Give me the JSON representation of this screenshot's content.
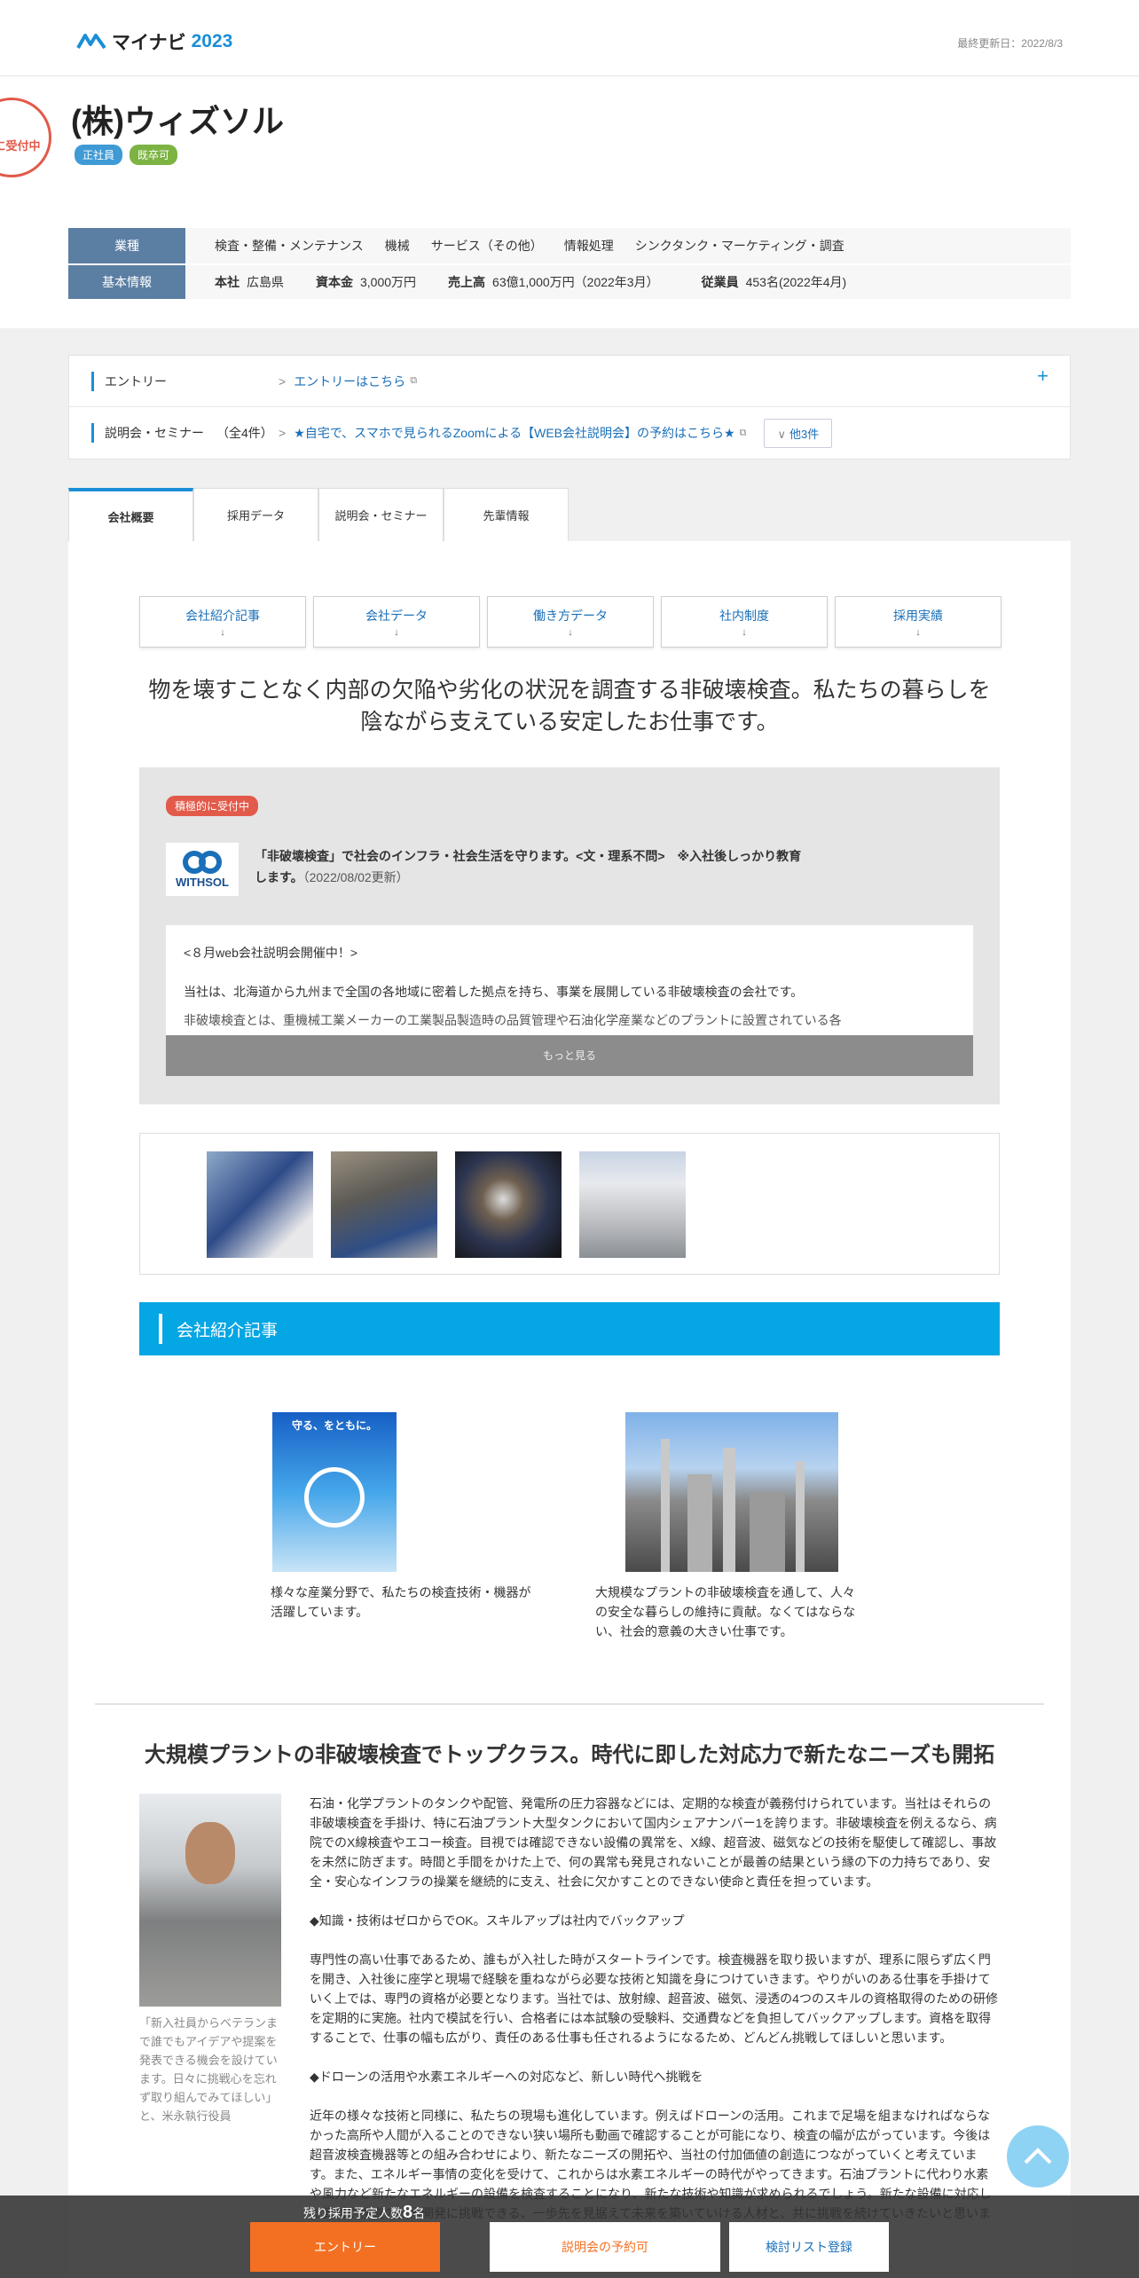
{
  "header": {
    "logo_text": "マイナビ",
    "logo_year": "2023",
    "updated": "最終更新日：2022/8/3"
  },
  "company": {
    "seal": "的に受付中",
    "name": "(株)ウィズソル",
    "tags": [
      "正社員",
      "既卒可"
    ]
  },
  "info": {
    "industry_label": "業種",
    "industries": [
      "検査・整備・メンテナンス",
      "機械",
      "サービス（その他）",
      "情報処理",
      "シンクタンク・マーケティング・調査"
    ],
    "basic_label": "基本情報",
    "hq_label": "本社",
    "hq": "広島県",
    "capital_label": "資本金",
    "capital": "3,000万円",
    "sales_label": "売上高",
    "sales": "63億1,000万円（2022年3月）",
    "employees_label": "従業員",
    "employees": "453名(2022年4月)"
  },
  "entry": {
    "entry_label": "エントリー",
    "entry_link": "エントリーはこちら",
    "seminar_label": "説明会・セミナー",
    "seminar_count": "（全4件）",
    "seminar_link": "★自宅で、スマホで見られるZoomによる【WEB会社説明会】の予約はこちら★",
    "others": "他3件",
    "plus": "+"
  },
  "tabs": [
    "会社概要",
    "採用データ",
    "説明会・セミナー",
    "先輩情報"
  ],
  "subnav": [
    "会社紹介記事",
    "会社データ",
    "働き方データ",
    "社内制度",
    "採用実績"
  ],
  "lead": "物を壊すことなく内部の欠陥や劣化の状況を調査する非破壊検査。私たちの暮らしを陰ながら支えている安定したお仕事です。",
  "message": {
    "badge": "積極的に受付中",
    "logo_text": "WITHSOL",
    "title": "「非破壊検査」で社会のインフラ・社会生活を守ります。<文・理系不問>　※入社後しっかり教育します。",
    "date": "（2022/08/02更新）",
    "p1": "<８月web会社説明会開催中！>",
    "p2": "当社は、北海道から九州まで全国の各地域に密着した拠点を持ち、事業を展開している非破壊検査の会社です。",
    "p3": "非破壊検査とは、重機械工業メーカーの工業製品製造時の品質管理や石油化学産業などのプラントに設置されている各",
    "more": "もっと見る"
  },
  "section_title": "会社紹介記事",
  "articles": [
    {
      "poster_text": "守る、をともに。",
      "caption": "様々な産業分野で、私たちの検査技術・機器が活躍しています。"
    },
    {
      "caption": "大規模なプラントの非破壊検査を通して、人々の安全な暮らしの維持に貢献。なくてはならない、社会的意義の大きい仕事です。"
    }
  ],
  "feature": {
    "heading": "大規模プラントの非破壊検査でトップクラス。時代に即した対応力で新たなニーズも開拓",
    "caption": "「新入社員からベテランまで誰でもアイデアや提案を発表できる機会を設けています。日々に挑戦心を忘れず取り組んでみてほしい」と、米永執行役員",
    "paragraphs": [
      "石油・化学プラントのタンクや配管、発電所の圧力容器などには、定期的な検査が義務付けられています。当社はそれらの非破壊検査を手掛け、特に石油プラント大型タンクにおいて国内シェアナンバー1を誇ります。非破壊検査を例えるなら、病院でのX線検査やエコー検査。目視では確認できない設備の異常を、X線、超音波、磁気などの技術を駆使して確認し、事故を未然に防ぎます。時間と手間をかけた上で、何の異常も発見されないことが最善の結果という縁の下の力持ちであり、安全・安心なインフラの操業を継続的に支え、社会に欠かすことのできない使命と責任を担っています。",
      "◆知識・技術はゼロからでOK。スキルアップは社内でバックアップ",
      "専門性の高い仕事であるため、誰もが入社した時がスタートラインです。検査機器を取り扱いますが、理系に限らず広く門を開き、入社後に座学と現場で経験を重ねながら必要な技術と知識を身につけていきます。やりがいのある仕事を手掛けていく上では、専門の資格が必要となります。当社では、放射線、超音波、磁気、浸透の4つのスキルの資格取得のための研修を定期的に実施。社内で模試を行い、合格者には本試験の受験料、交通費などを負担してバックアップします。資格を取得することで、仕事の幅も広がり、責任のある仕事も任されるようになるため、どんどん挑戦してほしいと思います。",
      "◆ドローンの活用や水素エネルギーへの対応など、新しい時代へ挑戦を",
      "近年の様々な技術と同様に、私たちの現場も進化しています。例えばドローンの活用。これまで足場を組まなければならなかった高所や人間が入ることのできない狭い場所も動画で確認することが可能になり、検査の幅が広がっています。今後は超音波検査機器等との組み合わせにより、新たなニーズの開拓や、当社の付加価値の創造につながっていくと考えています。また、エネルギー事情の変化を受けて、これからは水素エネルギーの時代がやってきます。石油プラントに代わり水素や風力など新たなエネルギーの設備を検査することになり、新たな技術や知識が求められるでしょう。新たな設備に対応した資材や検査の技術開発に挑戦できる、一歩先を見据えて未来を築いていける人材と、共に挑戦を続けていきたいと思います。"
    ]
  },
  "bottom": {
    "remain_prefix": "残り採用予定人数",
    "remain_num": "8",
    "remain_suffix": "名",
    "entry": "エントリー",
    "reserve": "説明会の予約可",
    "list": "検討リスト登録"
  },
  "colors": {
    "accent": "#1a8fd6",
    "section_blue": "#05a6e4",
    "entry_orange": "#f37022",
    "hot_red": "#e25a4a",
    "info_key": "#5b7ea3"
  }
}
